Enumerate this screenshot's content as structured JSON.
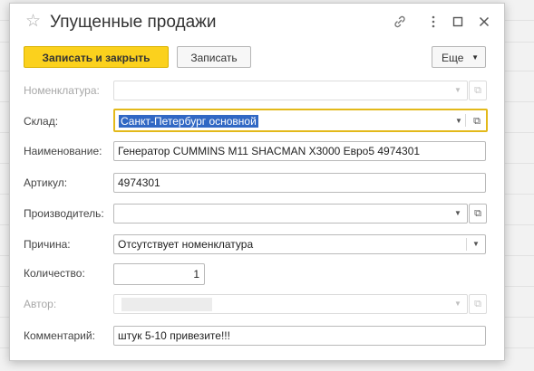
{
  "window": {
    "title": "Упущенные продажи"
  },
  "toolbar": {
    "save_close_label": "Записать и закрыть",
    "save_label": "Записать",
    "more_label": "Еще"
  },
  "form": {
    "nomenclature": {
      "label": "Номенклатура:",
      "value": ""
    },
    "warehouse": {
      "label": "Склад:",
      "value": "Санкт-Петербург основной"
    },
    "name": {
      "label": "Наименование:",
      "value": "Генератор CUMMINS M11 SHACMAN X3000 Евро5 4974301"
    },
    "article": {
      "label": "Артикул:",
      "value": "4974301"
    },
    "manufacturer": {
      "label": "Производитель:",
      "value": ""
    },
    "reason": {
      "label": "Причина:",
      "value": "Отсутствует номенклатура"
    },
    "quantity": {
      "label": "Количество:",
      "value": "1"
    },
    "author": {
      "label": "Автор:",
      "value": ""
    },
    "comment": {
      "label": "Комментарий:",
      "value": "штук 5-10 привезите!!!"
    }
  },
  "icons": {
    "star": "star-icon",
    "link": "link-icon",
    "menu": "more-vertical-icon",
    "maximize": "maximize-icon",
    "close": "close-icon",
    "dropdown": "chevron-down-icon",
    "open": "open-external-icon"
  }
}
